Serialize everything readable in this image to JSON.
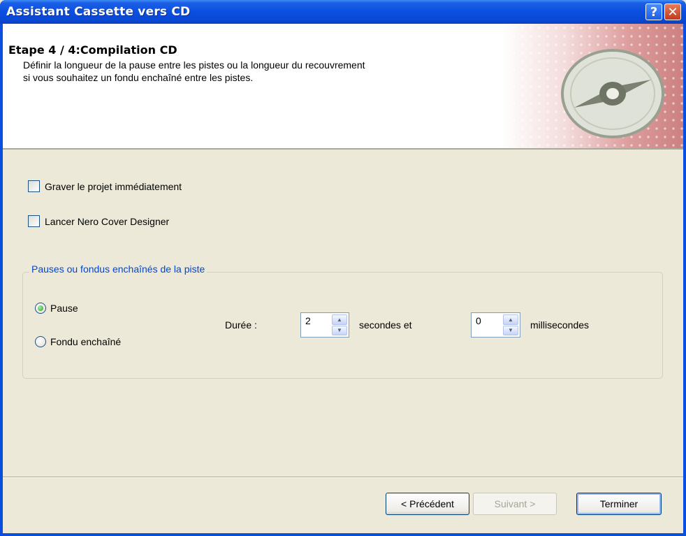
{
  "window": {
    "title": "Assistant Cassette vers CD",
    "help_glyph": "?",
    "close_glyph": "✕"
  },
  "header": {
    "step_title": "Etape 4 / 4:Compilation CD",
    "description_line1": "Définir la longueur de la pause entre les pistes ou la longueur du recouvrement",
    "description_line2": "si vous souhaitez un fondu enchaîné entre les pistes.",
    "icon": "cd-disc-icon"
  },
  "options": {
    "burn_now": {
      "label": "Graver le projet immédiatement",
      "checked": false
    },
    "cover_designer": {
      "label": "Lancer Nero Cover Designer",
      "checked": false
    }
  },
  "track_group": {
    "legend": "Pauses ou fondus enchaînés de la piste",
    "radio_pause": {
      "label": "Pause",
      "selected": true
    },
    "radio_crossfade": {
      "label": "Fondu enchaîné",
      "selected": false
    },
    "duration_label": "Durée :",
    "seconds_value": "2",
    "seconds_label": "secondes et",
    "ms_value": "0",
    "ms_label": "millisecondes"
  },
  "footer": {
    "prev_label": "< Précédent",
    "next_label": "Suivant >",
    "finish_label": "Terminer"
  },
  "colors": {
    "title_bar": "#0a4ee0",
    "dialog_bg": "#ece9d8",
    "group_legend": "#0046d5"
  }
}
